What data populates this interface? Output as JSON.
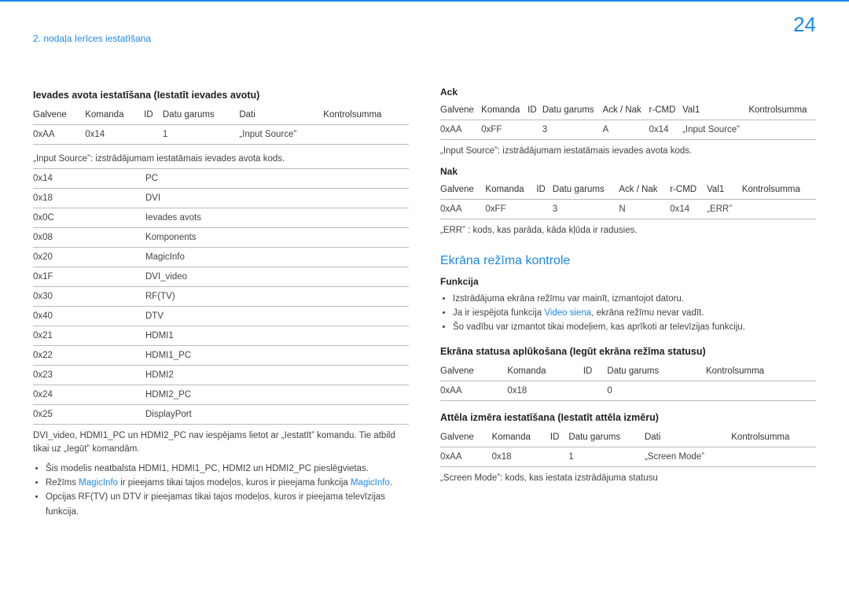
{
  "page_number": "24",
  "chapter": "2. nodaļa Ierīces iestatīšana",
  "left": {
    "title": "Ievades avota iestatīšana (Iestatīt ievades avotu)",
    "table1": {
      "headers": [
        "Galvene",
        "Komanda",
        "ID",
        "Datu garums",
        "Dati",
        "Kontrolsumma"
      ],
      "row": [
        "0xAA",
        "0x14",
        "",
        "1",
        "„Input Source”",
        ""
      ]
    },
    "input_note": "„Input Source”: izstrādājumam iestatāmais ievades avota kods.",
    "codes": [
      [
        "0x14",
        "PC"
      ],
      [
        "0x18",
        "DVI"
      ],
      [
        "0x0C",
        "Ievades avots"
      ],
      [
        "0x08",
        "Komponents"
      ],
      [
        "0x20",
        "MagicInfo"
      ],
      [
        "0x1F",
        "DVI_video"
      ],
      [
        "0x30",
        "RF(TV)"
      ],
      [
        "0x40",
        "DTV"
      ],
      [
        "0x21",
        "HDMI1"
      ],
      [
        "0x22",
        "HDMI1_PC"
      ],
      [
        "0x23",
        "HDMI2"
      ],
      [
        "0x24",
        "HDMI2_PC"
      ],
      [
        "0x25",
        "DisplayPort"
      ]
    ],
    "post_note": "DVI_video, HDMI1_PC un HDMI2_PC nav iespējams lietot ar „Iestatīt” komandu. Tie atbild tikai uz „Iegūt” komandām.",
    "bullets": {
      "b1": "Šis modelis neatbalsta HDMI1, HDMI1_PC, HDMI2 un HDMI2_PC pieslēgvietas.",
      "b2_pre": "Režīms ",
      "b2_link1": "MagicInfo",
      "b2_mid": " ir pieejams tikai tajos modeļos, kuros ir pieejama funkcija ",
      "b2_link2": "MagicInfo",
      "b2_post": ".",
      "b3": "Opcijas RF(TV) un DTV ir pieejamas tikai tajos modeļos, kuros ir pieejama televīzijas funkcija."
    }
  },
  "right": {
    "ack_title": "Ack",
    "ack_table": {
      "headers": [
        "Galvene",
        "Komanda",
        "ID",
        "Datu garums",
        "Ack / Nak",
        "r-CMD",
        "Val1",
        "Kontrolsumma"
      ],
      "row": [
        "0xAA",
        "0xFF",
        "",
        "3",
        "A",
        "0x14",
        "„Input Source”",
        ""
      ]
    },
    "ack_note": "„Input Source”: izstrādājumam iestatāmais ievades avota kods.",
    "nak_title": "Nak",
    "nak_table": {
      "headers": [
        "Galvene",
        "Komanda",
        "ID",
        "Datu garums",
        "Ack / Nak",
        "r-CMD",
        "Val1",
        "Kontrolsumma"
      ],
      "row": [
        "0xAA",
        "0xFF",
        "",
        "3",
        "N",
        "0x14",
        "„ERR”",
        ""
      ]
    },
    "nak_note": "„ERR” : kods, kas parāda, kāda kļūda ir radusies.",
    "screen_mode_title": "Ekrāna režīma kontrole",
    "func_title": "Funkcija",
    "func_bullets": {
      "b1": "Izstrādājuma ekrāna režīmu var mainīt, izmantojot datoru.",
      "b2_pre": "Ja ir iespējota funkcija ",
      "b2_link": "Video siena",
      "b2_post": ", ekrāna režīmu nevar vadīt.",
      "b3": "Šo vadību var izmantot tikai modeļiem, kas aprīkoti ar televīzijas funkciju."
    },
    "status_title": "Ekrāna statusa aplūkošana (Iegūt ekrāna režīma statusu)",
    "status_table": {
      "headers": [
        "Galvene",
        "Komanda",
        "ID",
        "Datu garums",
        "Kontrolsumma"
      ],
      "row": [
        "0xAA",
        "0x18",
        "",
        "0",
        ""
      ]
    },
    "size_title": "Attēla izmēra iestatīšana (Iestatīt attēla izmēru)",
    "size_table": {
      "headers": [
        "Galvene",
        "Komanda",
        "ID",
        "Datu garums",
        "Dati",
        "Kontrolsumma"
      ],
      "row": [
        "0xAA",
        "0x18",
        "",
        "1",
        "„Screen Mode”",
        ""
      ]
    },
    "size_note": "„Screen Mode”: kods, kas iestata izstrādājuma statusu"
  }
}
